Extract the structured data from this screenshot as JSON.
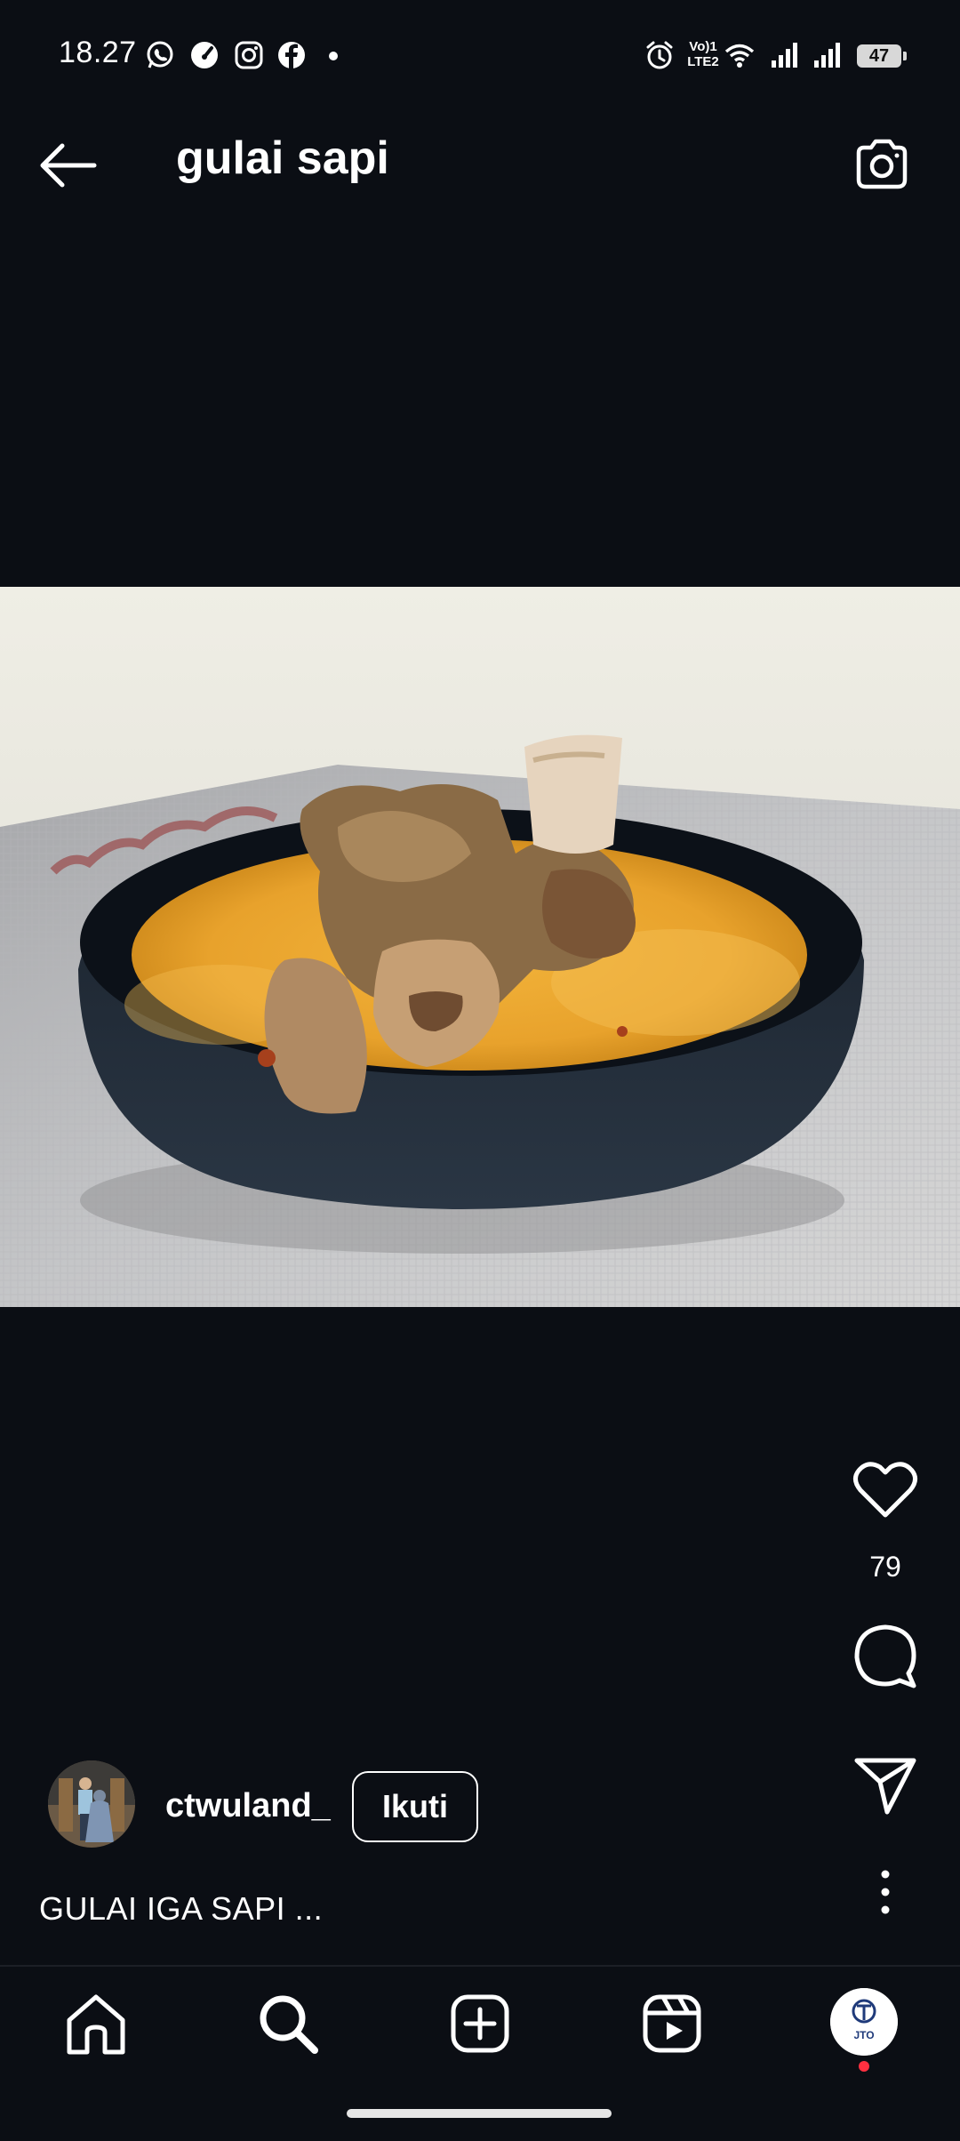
{
  "status": {
    "time": "18.27",
    "battery": "47",
    "net_label_1": "Vo)1",
    "net_label_2": "LTE2",
    "icons_left": [
      "whatsapp-icon",
      "speedometer-icon",
      "instagram-icon",
      "facebook-icon",
      "dot-icon"
    ],
    "icons_right": [
      "alarm-icon",
      "volte-icon",
      "wifi-icon",
      "signal-icon",
      "signal-icon",
      "battery-icon"
    ]
  },
  "header": {
    "title": "gulai sapi"
  },
  "post": {
    "likes": "79",
    "username": "ctwuland_",
    "follow_label": "Ikuti",
    "caption": "GULAI IGA SAPI ..."
  },
  "nav": {
    "items": [
      "home-icon",
      "search-icon",
      "create-icon",
      "reels-icon",
      "profile-avatar"
    ],
    "active": "search-icon",
    "profile_logo_text": "JTO"
  },
  "colors": {
    "background": "#0b0e14",
    "foreground": "#ffffff",
    "notification_dot": "#ff3040"
  }
}
